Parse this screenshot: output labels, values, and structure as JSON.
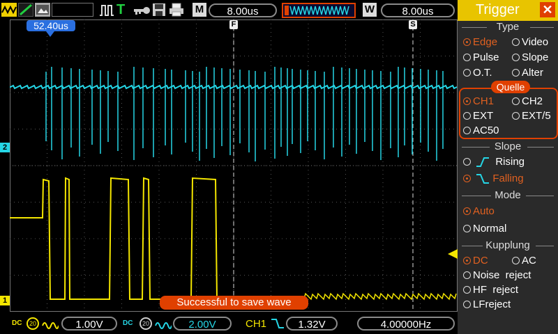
{
  "top": {
    "mode_letter": "M",
    "timebase": "8.00us",
    "window_letter": "W",
    "window_timebase": "8.00us",
    "t_label": "T"
  },
  "screen": {
    "time_offset": "52.40us",
    "marker_f": "F",
    "marker_s": "S",
    "ch2_marker": "2",
    "ch1_marker": "1",
    "toast": "Successful to save wave"
  },
  "bottom": {
    "ch1_volts": "1.00V",
    "ch2_volts": "2.00V",
    "trig_channel": "CH1",
    "trig_level": "1.32V",
    "frequency": "4.00000Hz",
    "ch1_coupling": "DC",
    "ch2_coupling": "DC",
    "bw_limit": "20"
  },
  "trigger": {
    "title": "Trigger",
    "type_title": "Type",
    "type_options": [
      "Edge",
      "Video",
      "Pulse",
      "Slope",
      "O.T.",
      "Alter"
    ],
    "source_title": "Quelle",
    "source_options": [
      "CH1",
      "CH2",
      "EXT",
      "EXT/5",
      "AC50"
    ],
    "slope_title": "Slope",
    "slope_options": [
      "Rising",
      "Falling"
    ],
    "mode_title": "Mode",
    "mode_options": [
      "Auto",
      "Normal"
    ],
    "coupling_title": "Kupplung",
    "coupling_options": [
      "DC",
      "AC",
      "Noise  reject",
      "HF  reject",
      "LFreject"
    ]
  },
  "colors": {
    "ch1": "#f4e600",
    "ch2": "#25d6e6",
    "accent": "#e04000",
    "panel": "#2a2a2a"
  }
}
